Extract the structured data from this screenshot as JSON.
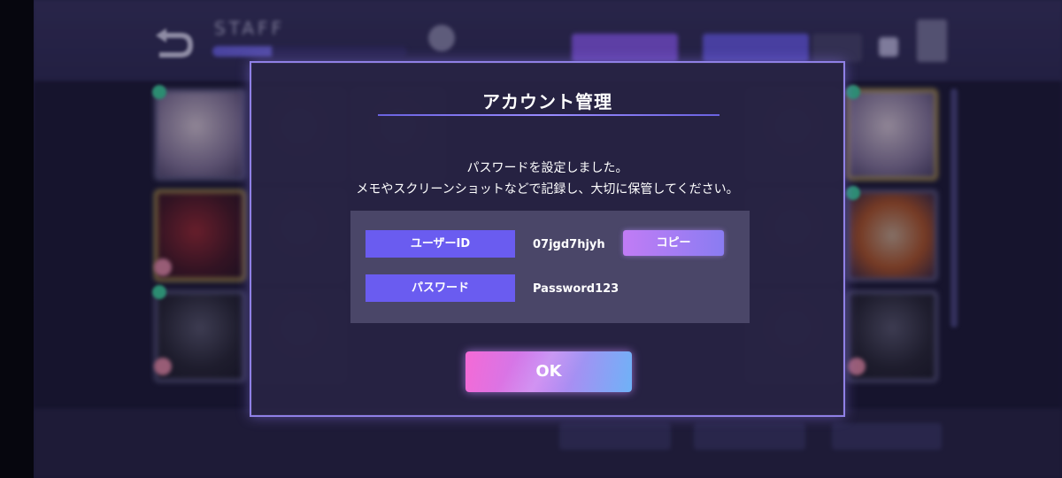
{
  "background": {
    "header_title": "STAFF"
  },
  "dialog": {
    "title": "アカウント管理",
    "message_line1": "パスワードを設定しました。",
    "message_line2": "メモやスクリーンショットなどで記録し、大切に保管してください。",
    "user_id_label": "ユーザーID",
    "user_id_value": "07jgd7hjyh",
    "copy_label": "コピー",
    "password_label": "パスワード",
    "password_value": "Password123",
    "ok_label": "OK"
  },
  "colors": {
    "accent": "#6a5cf0",
    "border": "#8f80e6",
    "ok_gradient_start": "#f46ad6",
    "ok_gradient_end": "#6fb2f7"
  }
}
